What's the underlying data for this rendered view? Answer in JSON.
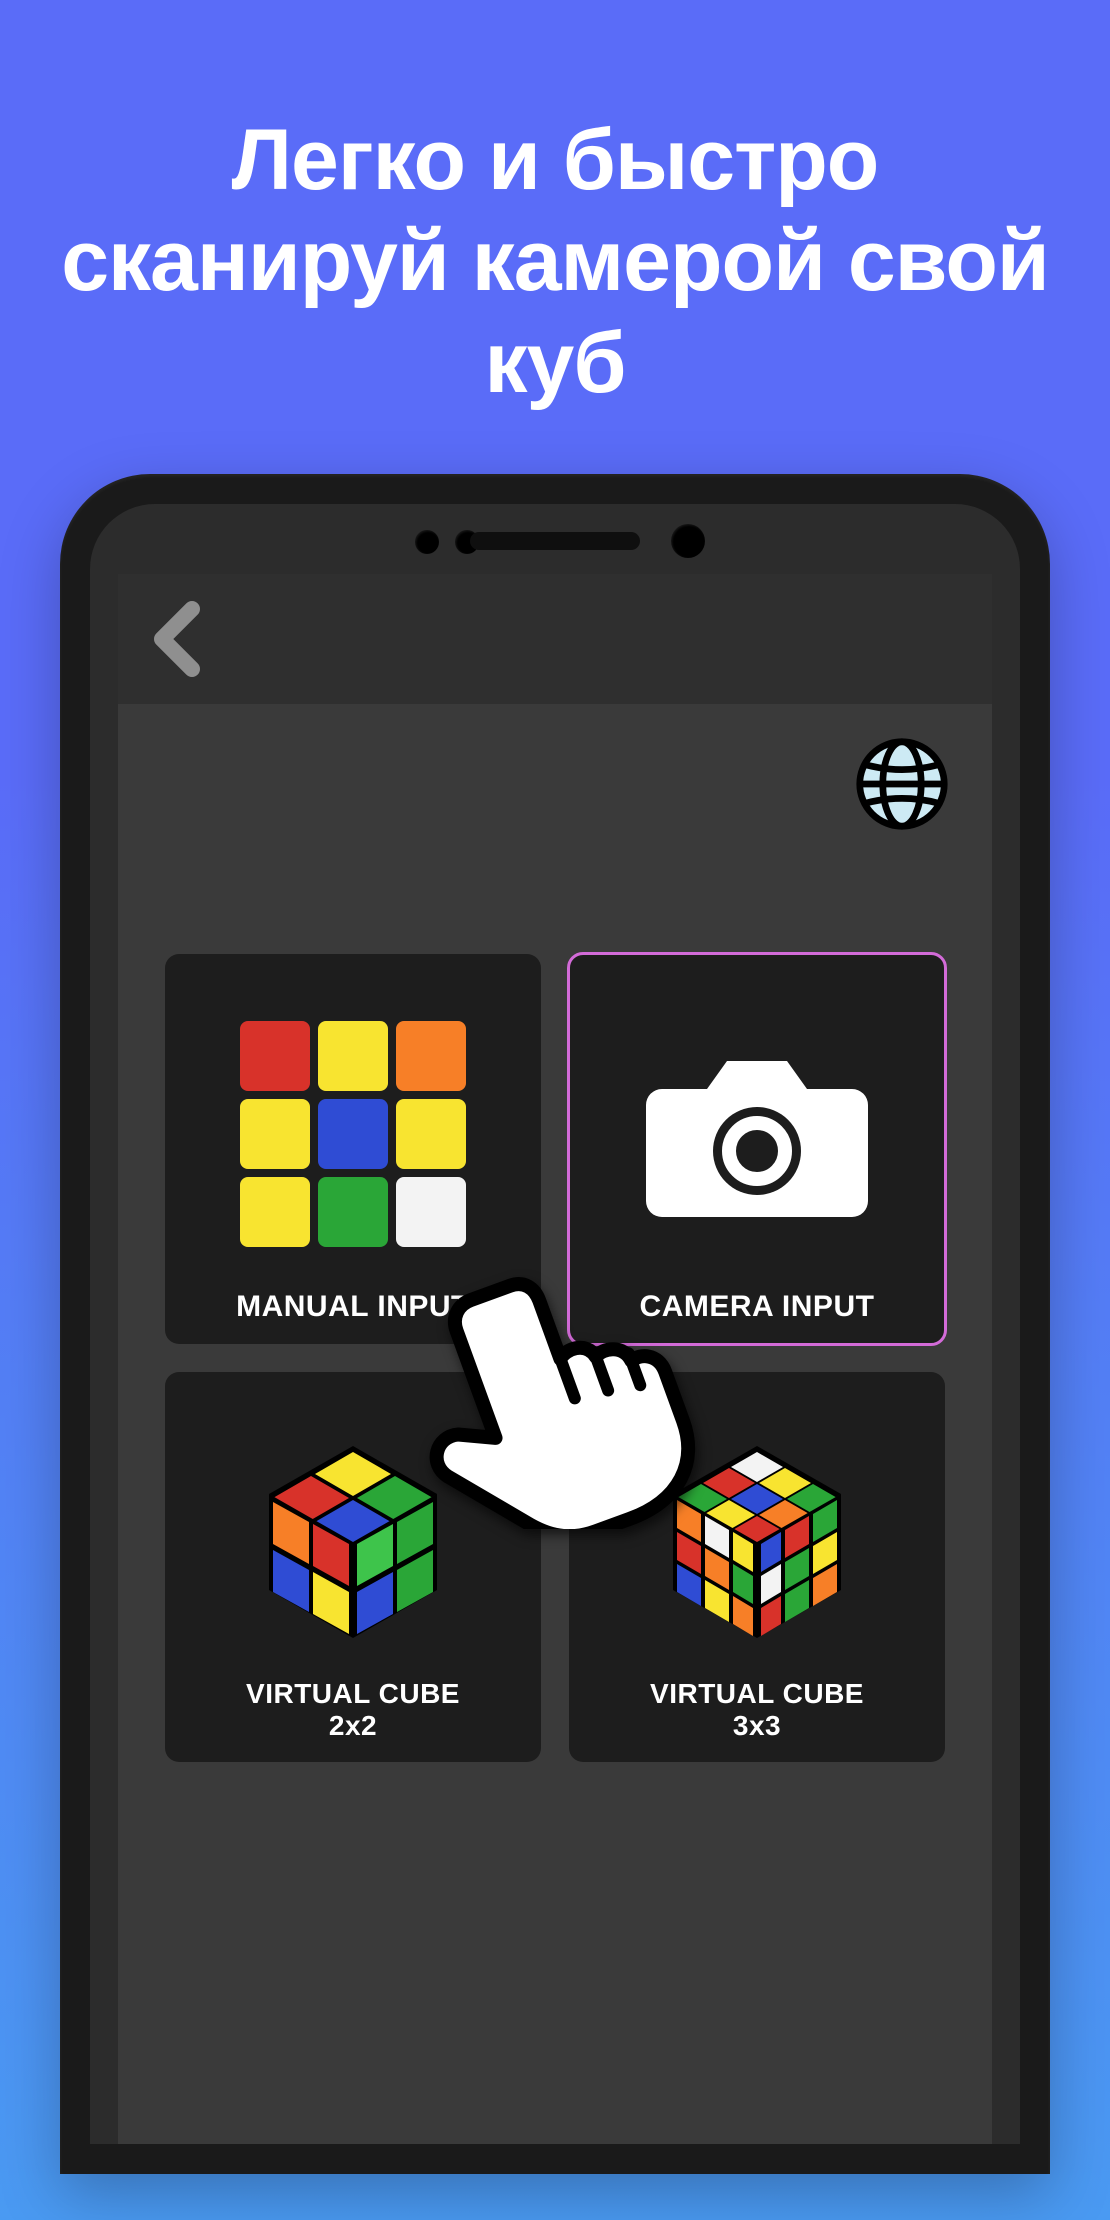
{
  "marketing": {
    "headline": "Легко и быстро сканируй камерой свой куб"
  },
  "screen": {
    "back_icon_name": "chevron-left-icon",
    "globe_icon_name": "globe-icon",
    "tiles": {
      "manual": {
        "label": "MANUAL INPUT"
      },
      "camera": {
        "label": "CAMERA INPUT"
      },
      "vc2": {
        "label": "VIRTUAL CUBE\n2x2"
      },
      "vc3": {
        "label": "VIRTUAL CUBE\n3x3"
      }
    },
    "manual_face_colors": [
      "red",
      "yellow",
      "orange",
      "yellow",
      "blue",
      "yellow",
      "yellow",
      "green",
      "white"
    ]
  }
}
